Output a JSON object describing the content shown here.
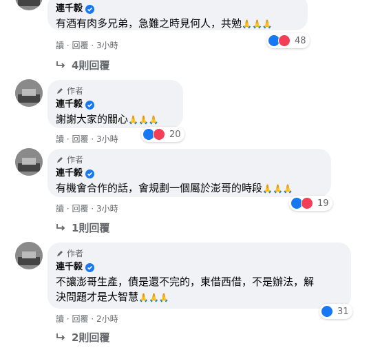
{
  "comments": [
    {
      "name": "連千毅",
      "text": "有酒有肉多兄弟，急難之時見何人，共勉",
      "emoji": "🙏🙏🙏",
      "reaction_count": "48",
      "meta": [
        "讀",
        "·",
        "回覆",
        "·",
        "3小時"
      ],
      "replies": "4則回覆"
    },
    {
      "author_tag": "作者",
      "name": "連千毅",
      "text": "謝謝大家的關心",
      "emoji": "🙏🙏🙏",
      "reaction_count": "20",
      "meta": [
        "讀",
        "·",
        "回覆",
        "·",
        "3小時"
      ]
    },
    {
      "author_tag": "作者",
      "name": "連千毅",
      "text": "有機會合作的話，會規劃一個屬於澎哥的時段",
      "emoji": "🙏🙏🙏",
      "reaction_count": "19",
      "meta": [
        "讀",
        "·",
        "回覆",
        "·",
        "3小時"
      ],
      "replies": "1則回覆"
    },
    {
      "author_tag": "作者",
      "name": "連千毅",
      "text_line1": "不讓澎哥生產，債是還不完的，東借西借，不是辦法，解",
      "text_line2": "決問題才是大智慧",
      "emoji": "🙏🙏🙏",
      "reaction_count": "31",
      "meta": [
        "讀",
        "·",
        "回覆",
        "·",
        "2小時"
      ],
      "replies": "2則回覆"
    }
  ],
  "colors": {
    "bubble": "#f0f2f5",
    "verified": "#1877f2",
    "like": "#1877f2",
    "love": "#f33e58",
    "meta": "#65676b"
  }
}
